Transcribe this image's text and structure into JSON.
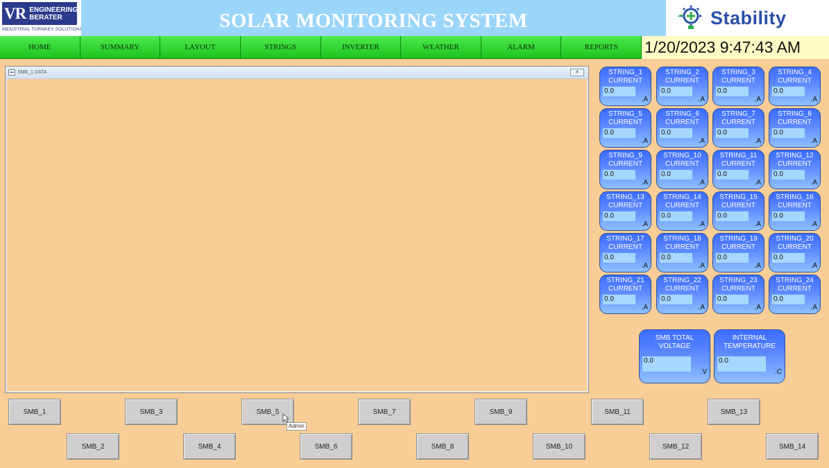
{
  "header": {
    "left_logo": {
      "mark": "VR",
      "line1": "ENGINEERING",
      "line2": "BERATER",
      "subtitle": "INDUSTRIAL TURNKEY SOLUTIONS"
    },
    "title": "SOLAR MONITORING SYSTEM",
    "right_logo": {
      "brand": "Stability"
    }
  },
  "nav": {
    "items": [
      "HOME",
      "SUMMARY",
      "LAYOUT",
      "STRINGS",
      "INVERTER",
      "WEATHER",
      "ALARM",
      "REPORTS"
    ]
  },
  "datetime": "1/20/2023 9:47:43 AM",
  "data_window": {
    "title": "SMB_1 DATA"
  },
  "strings": [
    {
      "label": "STRING_1",
      "sub": "CURRENT",
      "value": "0.0",
      "unit": ".A"
    },
    {
      "label": "STRING_2",
      "sub": "CURRENT",
      "value": "0.0",
      "unit": ".A"
    },
    {
      "label": "STRING_3",
      "sub": "CURRENT",
      "value": "0.0",
      "unit": ".A"
    },
    {
      "label": "STRING_4",
      "sub": "CURRENT",
      "value": "0.0",
      "unit": ".A"
    },
    {
      "label": "STRING_5",
      "sub": "CURRENT",
      "value": "0.0",
      "unit": ".A"
    },
    {
      "label": "STRING_6",
      "sub": "CURRENT",
      "value": "0.0",
      "unit": ".A"
    },
    {
      "label": "STRING_7",
      "sub": "CURRENT",
      "value": "0.0",
      "unit": ".A"
    },
    {
      "label": "STRING_8",
      "sub": "CURRENT",
      "value": "0.0",
      "unit": ".A"
    },
    {
      "label": "STRING_9",
      "sub": "CURRENT",
      "value": "0.0",
      "unit": ".A"
    },
    {
      "label": "STRING_10",
      "sub": "CURRENT",
      "value": "0.0",
      "unit": ".A"
    },
    {
      "label": "STRING_11",
      "sub": "CURRENT",
      "value": "0.0",
      "unit": ".A"
    },
    {
      "label": "STRING_12",
      "sub": "CURRENT",
      "value": "0.0",
      "unit": ".A"
    },
    {
      "label": "STRING_13",
      "sub": "CURRENT",
      "value": "0.0",
      "unit": ".A"
    },
    {
      "label": "STRING_14",
      "sub": "CURRENT",
      "value": "0.0",
      "unit": ".A"
    },
    {
      "label": "STRING_15",
      "sub": "CURRENT",
      "value": "0.0",
      "unit": ".A"
    },
    {
      "label": "STRING_16",
      "sub": "CURRENT",
      "value": "0.0",
      "unit": ".A"
    },
    {
      "label": "STRING_17",
      "sub": "CURRENT",
      "value": "0.0",
      "unit": ".A"
    },
    {
      "label": "STRING_18",
      "sub": "CURRENT",
      "value": "0.0",
      "unit": ".A"
    },
    {
      "label": "STRING_19",
      "sub": "CURRENT",
      "value": "0.0",
      "unit": ".A"
    },
    {
      "label": "STRING_20",
      "sub": "CURRENT",
      "value": "0.0",
      "unit": ".A"
    },
    {
      "label": "STRING_21",
      "sub": "CURRENT",
      "value": "0.0",
      "unit": ".A"
    },
    {
      "label": "STRING_22",
      "sub": "CURRENT",
      "value": "0.0",
      "unit": ".A"
    },
    {
      "label": "STRING_23",
      "sub": "CURRENT",
      "value": "0.0",
      "unit": ".A"
    },
    {
      "label": "STRING_24",
      "sub": "CURRENT",
      "value": "0.0",
      "unit": ".A"
    }
  ],
  "totals": [
    {
      "label": "SMB TOTAL",
      "sub": "VOLTAGE",
      "value": "0.0",
      "unit": ".V"
    },
    {
      "label": "INTERNAL",
      "sub": "TEMPERATURE",
      "value": "0.0",
      "unit": ".C"
    }
  ],
  "smb_buttons": [
    "SMB_1",
    "SMB_2",
    "SMB_3",
    "SMB_4",
    "SMB_5",
    "SMB_6",
    "SMB_7",
    "SMB_8",
    "SMB_9",
    "SMB_10",
    "SMB_11",
    "SMB_12",
    "SMB_13",
    "SMB_14"
  ],
  "tooltip": "Admin",
  "icons": {
    "cursor": "mouse-pointer-icon",
    "window": "window-icon",
    "close": "close-icon",
    "logo": "lightbulb-gear-icon"
  }
}
